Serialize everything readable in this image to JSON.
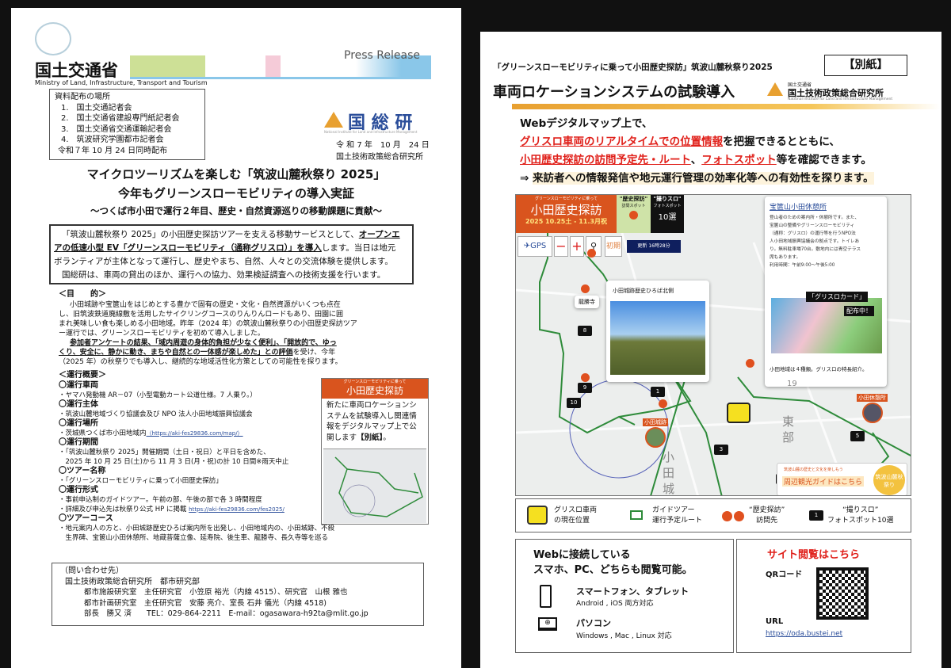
{
  "p1": {
    "logo_text": "国土交通省",
    "ministry_en": "Ministry of Land, Infrastructure, Transport and Tourism",
    "press_release": "Press Release",
    "distribution": {
      "title": "資料配布の場所",
      "items": [
        "1.　国土交通記者会",
        "2.　国土交通省建設専門紙記者会",
        "3.　国土交通省交通運輸記者会",
        "4.　筑波研究学園都市記者会"
      ],
      "date": "令和７年 10 月 24 日同時配布"
    },
    "nilim_logo": "国 総 研",
    "nilim_en": "National Institute for Land and Infrastructure Management",
    "date": "令 和 7 年　10 月　24 日",
    "institute": "国土技術政策総合研究所",
    "title1": "マイクロツーリズムを楽しむ「筑波山麓秋祭り 2025」",
    "title2": "今年もグリーンスローモビリティの導入実証",
    "subtitle": "～つくば市小田で運行２年目、歴史・自然資源巡りの移動課題に貢献～",
    "summary": {
      "l1a": "「筑波山麓秋祭り 2025」の小田歴史探訪ツアーを支える移動サービスとして、",
      "l1b": "オープンエ",
      "l2a": "アの低速小型 EV「グリーンスローモビリティ（通称グリスロ）」を導入",
      "l2b": "します。当日は地元",
      "l3": "ボランティアが主体となって運行し、歴史やまち、自然、人々との交流体験を提供します。",
      "l4": "国総研は、車両の貸出のほか、運行への協力、効果検証調査への技術支援を行います。"
    },
    "purpose": {
      "heading": "＜目　　的＞",
      "lines": [
        "小田城跡や宝篋山をはじめとする豊かで固有の歴史・文化・自然資源がいくつも点在",
        "し、旧筑波鉄道廃線敷を活用したサイクリングコースのりんりんロードもあり、田園に囲",
        "まれ美味しい食も楽しめる小田地域。昨年（2024 年）の筑波山麓秋祭りの小田歴史探訪ツア",
        "ー運行では、グリーンスローモビリティを初めて導入しました。"
      ],
      "bold1": "参加者アンケートの結果、「域内周遊の身体的負担が少なく便利」、「開放的で、ゆっ",
      "bold2": "くり、安全に、静かに動き、まちや自然との一体感が楽しめた」との評価",
      "bold2_rest": "を受け、今年",
      "last": "（2025 年）の秋祭りでも導入し、継続的な地域活性化方策としての可能性を探ります。"
    },
    "overview": {
      "heading": "＜運行概要＞",
      "sections": [
        {
          "title": "〇運行車両",
          "lines": [
            "・ヤマハ発動機 AR－07（小型電動カート公道仕様。7 人乗り。）"
          ]
        },
        {
          "title": "〇運行主体",
          "lines": [
            "・筑波山麓地域づくり協議会及び NPO 法人小田地域振興協議会"
          ]
        },
        {
          "title": "〇運行場所",
          "lines": [
            "・茨城県つくば市小田地域内"
          ],
          "link": "（https://aki-fes29836.com/map/）"
        },
        {
          "title": "〇運行期間",
          "lines": [
            "・「筑波山麓秋祭り 2025」開催期間（土日・祝日）と平日を含めた、",
            "　2025 年 10 月 25 日(土)から 11 月 3 日(月・祝)の計 10 日間※雨天中止"
          ]
        },
        {
          "title": "〇ツアー名称",
          "lines": [
            "・「グリーンスローモビリティに乗って小田歴史探訪」"
          ]
        },
        {
          "title": "〇運行形式",
          "lines": [
            "・事前申込制のガイドツアー。午前の部、午後の部で各 3 時間程度",
            "・詳細及び申込先は秋祭り公式 HP に掲載"
          ],
          "link": "https://aki-fes29836.com/fes2025/"
        },
        {
          "title": "〇ツアーコース",
          "lines": [
            "・地元案内人の方と、小田城跡歴史ひろば案内所を出発し、小田地域内の、小田城跡、不殺",
            "　生界碑、宝篋山小田休憩所、地蔵菩薩立像、延寿院、後生車、龍勝寺、長久寺等を巡る"
          ]
        }
      ]
    },
    "inset": {
      "banner_small": "グリーンスローモビリティに乗って",
      "banner": "小田歴史探訪",
      "lines": [
        "新たに車両ロケーションシ",
        "ステムを試験導入し関連情",
        "報をデジタルマップ上で公"
      ],
      "last": "開します",
      "bold": "【別紙】",
      "end": "。"
    },
    "contact": {
      "title": "（問い合わせ先）",
      "org": "国土技術政策総合研究所　都市研究部",
      "lines": [
        "都市施設研究室　主任研究官　小笠原 裕光（内線 4515）、研究官　山根 雅也",
        "都市計画研究室　主任研究官　安藤 亮介、室長 石井 儀光（内線 4518)",
        "部長　勝又 済　　TEL：029-864-2211　E-mail：ogasawara-h92ta@mlit.go.jp"
      ]
    }
  },
  "p2": {
    "header": "「グリーンスローモビリティに乗って小田歴史探訪」筑波山麓秋祭り2025",
    "appendix": "【別紙】",
    "title": "車両ロケーションシステムの試験導入",
    "org_small": "国土交通省",
    "org": "国土技術政策総合研究所",
    "org_en": "National Institute for Land and Infrastructure Management",
    "intro": {
      "l1": "Webデジタルマップ上で、",
      "l2red": "グリスロ車両のリアルタイムでの位置情報",
      "l2": "を把握できるとともに、",
      "l3red": "小田歴史探訪の訪問予定先・ルート",
      "l3sep": "、",
      "l3red2": "フォトスポット",
      "l3": "等を確認できます。",
      "arrow": "⇒",
      "l4": "来訪者への情報発信や地元運行管理の効率化等への有効性を探ります。"
    },
    "map": {
      "banner_small": "グリーンスローモビリティに乗って",
      "banner": "小田歴史探訪",
      "banner_dates": "2025 10.25土 - 11.3月祝",
      "history_label": "\"歴史探訪\"",
      "history_sub": "訪問スポット",
      "photo_label": "\"撮りスロ\"",
      "photo_sub": "フォトスポット",
      "photo_count": "10選",
      "gps": "GPS",
      "zoom_out": "−",
      "zoom_in": "+",
      "reset": "初期",
      "updated": "更新 16時28分",
      "popup1_title": "小田城跡歴史ひろば北側",
      "ryusho": "龍勝寺",
      "popup2": {
        "title": "宝篋山小田休憩所",
        "lines": [
          "登山者のための案内所・休憩所です。また、",
          "宝篋山の整備やグリーンスローモビリティ",
          "（通称：グリスロ）の運行等を行うNPO法",
          "人小田地域振興協議会の拠点です。トイレあ",
          "り。無料駐車場70台。敷地内には青空テラス",
          "席もあります。"
        ],
        "hours": "利用時間：午前9:00～午後5:00",
        "card1": "「グリスロカード」",
        "card2": "配布中！",
        "caption": "小田地域は４種類。グリスロの特長紹介。"
      },
      "odajo": "小田城跡",
      "kyukei": "小田休憩所",
      "place1": "小",
      "place2": "田",
      "place3": "城",
      "place4": "東",
      "place5": "部",
      "road": "19",
      "cams": [
        "8",
        "9",
        "10",
        "1",
        "3",
        "5",
        "4"
      ],
      "guide_small": "筑波山麓の歴史と文化を楽しもう",
      "guide": "周辺観光ガイドはこちら",
      "fest_logo": "筑波山麓秋祭り"
    },
    "legend": [
      {
        "l1": "グリスロ車両",
        "l2": "の現在位置"
      },
      {
        "l1": "ガイドツアー",
        "l2": "運行予定ルート"
      },
      {
        "l1": "“歴史探訪”",
        "l2": "訪問先"
      },
      {
        "l1": "“撮りスロ”",
        "l2": "フォトスポット10選"
      }
    ],
    "devices": {
      "l1": "Webに接続している",
      "l2": "スマホ、PC、どちらも閲覧可能。",
      "phone": "スマートフォン、タブレット",
      "phone_sub": "Android , iOS 両方対応",
      "pc": "パソコン",
      "pc_sub": "Windows , Mac , Linux  対応"
    },
    "site": {
      "title": "サイト閲覧はこちら",
      "qr": "QRコード",
      "url_label": "URL",
      "url": "https://oda.bustei.net"
    },
    "colors": {
      "accent_red": "#e0201a",
      "route_green": "#2e8b3a",
      "marker_orange": "#e0501f",
      "bar_orange": "#e8a030"
    }
  }
}
